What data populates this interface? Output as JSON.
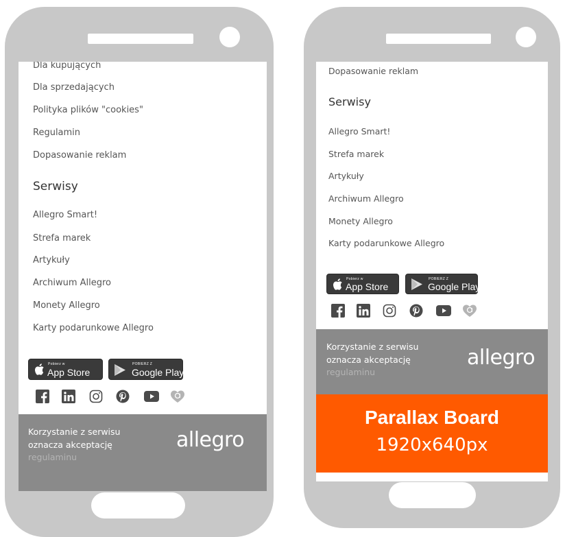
{
  "left_phone": {
    "links_top": [
      "Dla kupujących",
      "Dla sprzedających",
      "Polityka plików \"cookies\"",
      "Regulamin",
      "Dopasowanie reklam"
    ],
    "section_heading": "Serwisy",
    "links_services": [
      "Allegro Smart!",
      "Strefa marek",
      "Artykuły",
      "Archiwum Allegro",
      "Monety Allegro",
      "Karty podarunkowe Allegro"
    ],
    "footer": {
      "line1": "Korzystanie z serwisu",
      "line2": "oznacza akceptację",
      "link": "regulaminu",
      "logo": "allegro"
    }
  },
  "right_phone": {
    "links_top": [
      "Dopasowanie reklam"
    ],
    "section_heading": "Serwisy",
    "links_services": [
      "Allegro Smart!",
      "Strefa marek",
      "Artykuły",
      "Archiwum Allegro",
      "Monety Allegro",
      "Karty podarunkowe Allegro"
    ],
    "footer": {
      "line1": "Korzystanie z serwisu",
      "line2": "oznacza akceptację",
      "link": "regulaminu",
      "logo": "allegro"
    },
    "parallax": {
      "title": "Parallax Board",
      "size": "1920x640px",
      "color": "#ff5a00"
    }
  },
  "app_store": {
    "small": "Pobierz w",
    "big": "App Store",
    "icon": "apple-icon"
  },
  "google_play": {
    "small": "POBIERZ Z",
    "big": "Google Play",
    "icon": "play-icon"
  },
  "social_icons": [
    "facebook-icon",
    "linkedin-icon",
    "instagram-icon",
    "pinterest-icon",
    "youtube-icon",
    "allegro-heart-icon"
  ]
}
